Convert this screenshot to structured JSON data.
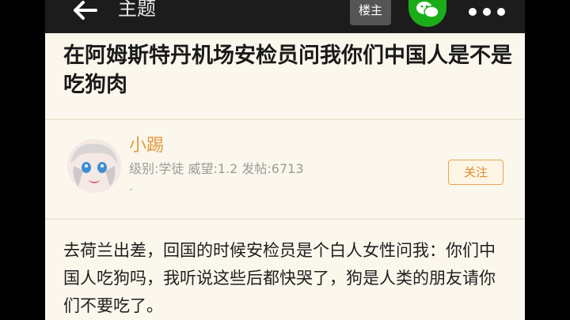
{
  "topbar": {
    "title": "主题",
    "louzhu_label": "楼主",
    "back_icon": "arrow-left-icon",
    "share_icon": "wechat-icon",
    "more_icon": "more-dots-icon"
  },
  "article": {
    "title": "在阿姆斯特丹机场安检员问我你们中国人是不是吃狗肉"
  },
  "author": {
    "name": "小踢",
    "stats": "级别:学徒 威望:1.2 发帖:6713",
    "extra": "-",
    "follow_label": "关注"
  },
  "post": {
    "text": "去荷兰出差，回国的时候安检员是个白人女性问我：你们中国人吃狗吗，我听说这些后都快哭了，狗是人类的朋友请你们不要吃了。"
  },
  "colors": {
    "topbar_bg": "#1c1c1c",
    "page_bg": "#fbf7ec",
    "accent_orange": "#e49a3c",
    "wechat_green": "#1aad19"
  }
}
